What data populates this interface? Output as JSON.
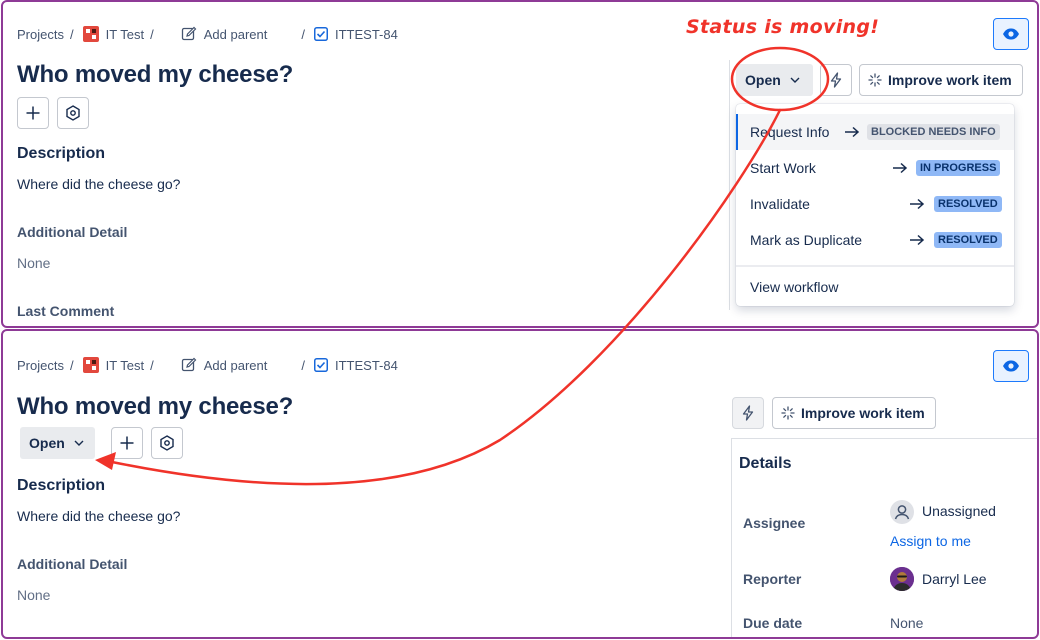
{
  "annotation": {
    "text": "Status is moving!",
    "color": "#f0332a"
  },
  "breadcrumb": {
    "projects": "Projects",
    "project": "IT Test",
    "add_parent": "Add parent",
    "issue_key": "ITTEST-84"
  },
  "issue": {
    "title": "Who moved my cheese?",
    "status": "Open",
    "improve_label": "Improve work item",
    "description_heading": "Description",
    "description_text": "Where did the cheese go?",
    "additional_heading": "Additional Detail",
    "additional_value": "None",
    "last_comment_heading": "Last Comment"
  },
  "status_menu": {
    "items": [
      {
        "label": "Request Info",
        "target": "BLOCKED NEEDS INFO",
        "style": "grey"
      },
      {
        "label": "Start Work",
        "target": "IN PROGRESS",
        "style": "blue"
      },
      {
        "label": "Invalidate",
        "target": "RESOLVED",
        "style": "blue"
      },
      {
        "label": "Mark as Duplicate",
        "target": "RESOLVED",
        "style": "blue"
      }
    ],
    "view_workflow": "View workflow"
  },
  "details": {
    "title": "Details",
    "assignee_label": "Assignee",
    "assignee_value": "Unassigned",
    "assign_to_me": "Assign to me",
    "reporter_label": "Reporter",
    "reporter_value": "Darryl Lee",
    "due_date_label": "Due date",
    "due_date_value": "None"
  },
  "icons": {
    "project": "project-avatar-icon",
    "add_parent": "edit-icon",
    "issue_type": "task-checkbox-icon",
    "add": "plus-icon",
    "apps": "hexagon-apps-icon",
    "automation": "lightning-icon",
    "ai": "sparkle-icon",
    "watch": "eye-icon",
    "status_dropdown": "chevron-down-icon",
    "transition": "arrow-right-icon"
  },
  "colors": {
    "panel_border": "#8e3a96",
    "lozenge_blue": "#8fb8f6",
    "lozenge_grey": "#dfe1e6",
    "link": "#0c66e4"
  }
}
